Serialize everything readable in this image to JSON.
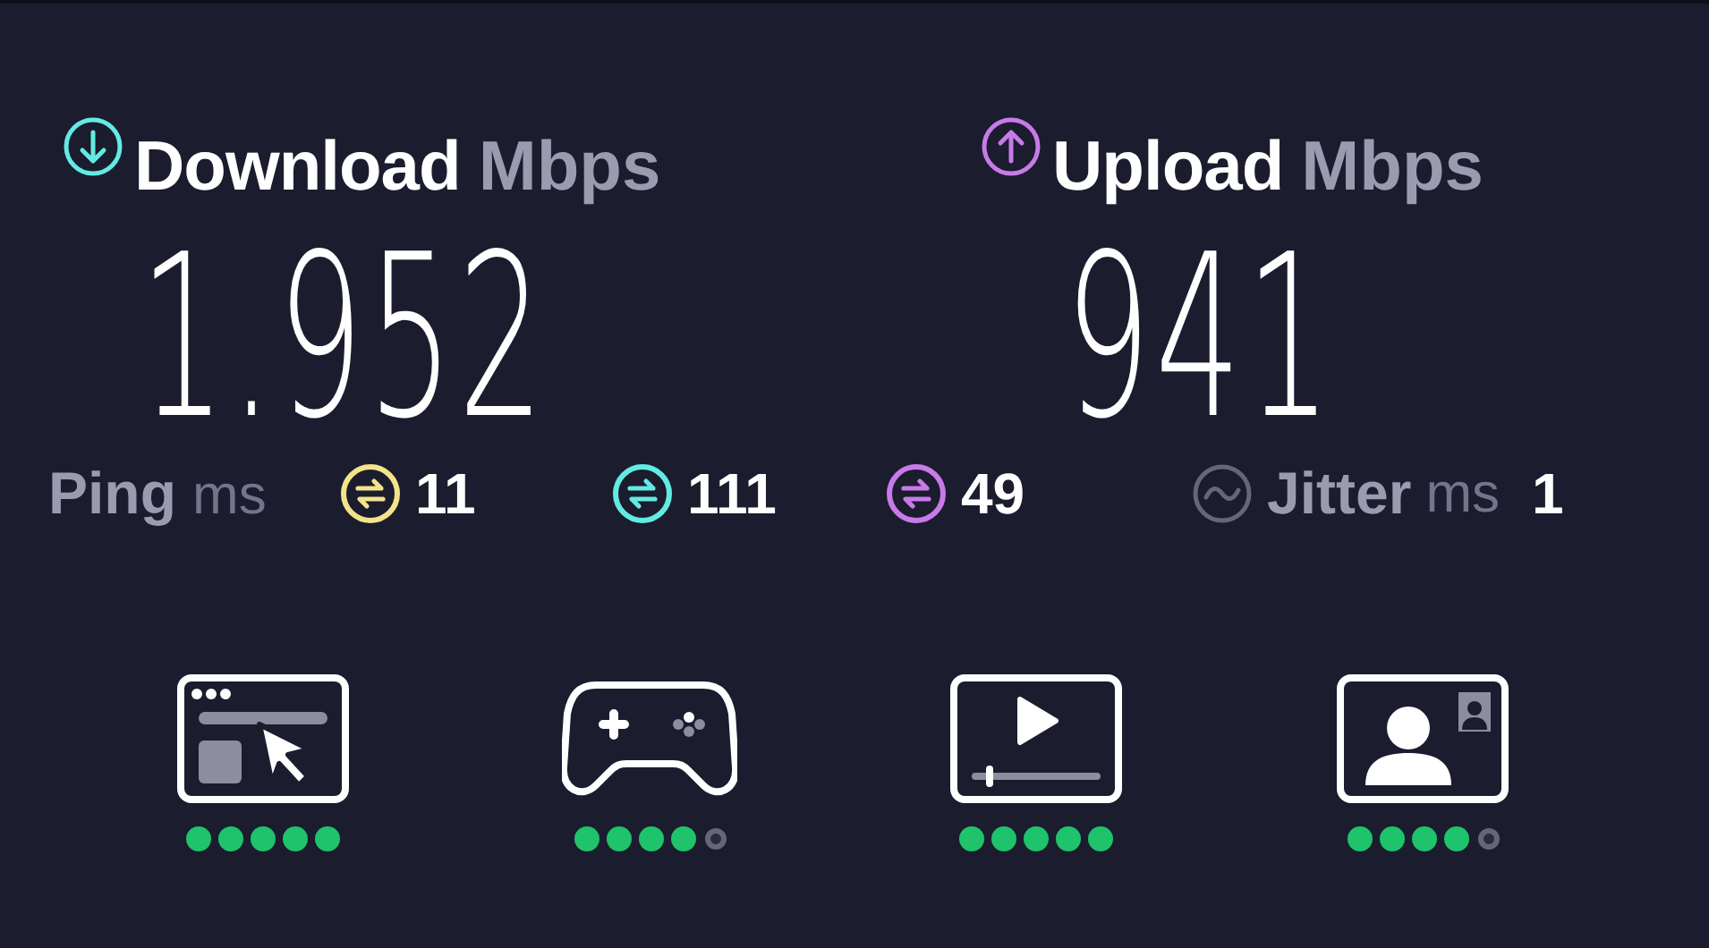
{
  "download": {
    "label": "Download",
    "unit": "Mbps",
    "value": "1.952"
  },
  "upload": {
    "label": "Upload",
    "unit": "Mbps",
    "value": "941"
  },
  "ping": {
    "label": "Ping",
    "unit": "ms",
    "readings": [
      {
        "value": "11",
        "color": "#f3e38a"
      },
      {
        "value": "111",
        "color": "#63ebe3"
      },
      {
        "value": "49",
        "color": "#c77ae8"
      }
    ]
  },
  "jitter": {
    "label": "Jitter",
    "unit": "ms",
    "value": "1"
  },
  "uses": [
    {
      "kind": "browsing",
      "stars": 5
    },
    {
      "kind": "gaming",
      "stars": 4
    },
    {
      "kind": "streaming",
      "stars": 5
    },
    {
      "kind": "video-call",
      "stars": 4
    }
  ]
}
